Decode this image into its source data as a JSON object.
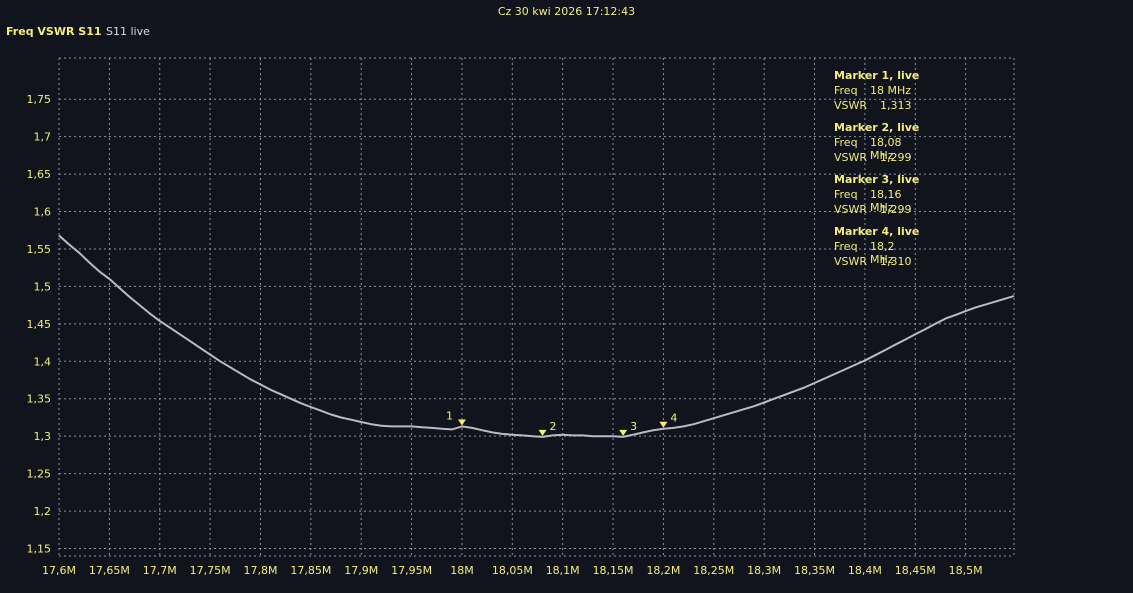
{
  "header": {
    "timestamp": "Cz 30 kwi 2026 17:12:43",
    "chart_title": "Freq VSWR S11",
    "trace_label": "S11 live"
  },
  "colors": {
    "background": "#11141c",
    "grid": "#8e93a0",
    "axis_text": "#f3ee7a",
    "trace": "#b9bcc4",
    "marker": "#f3ee7a"
  },
  "markers_panel": [
    {
      "title": "Marker 1, live",
      "freq_label": "Freq",
      "freq_value": "18 MHz",
      "vswr_label": "VSWR",
      "vswr_value": "1,313"
    },
    {
      "title": "Marker 2, live",
      "freq_label": "Freq",
      "freq_value": "18,08 MHz",
      "vswr_label": "VSWR",
      "vswr_value": "1,299"
    },
    {
      "title": "Marker 3, live",
      "freq_label": "Freq",
      "freq_value": "18,16 MHz",
      "vswr_label": "VSWR",
      "vswr_value": "1,299"
    },
    {
      "title": "Marker 4, live",
      "freq_label": "Freq",
      "freq_value": "18,2 MHz",
      "vswr_label": "VSWR",
      "vswr_value": "1,310"
    }
  ],
  "chart_data": {
    "type": "line",
    "title": "Freq VSWR S11",
    "xlabel": "",
    "ylabel": "",
    "xlim": [
      17.6,
      18.548
    ],
    "ylim": [
      1.14,
      1.805
    ],
    "grid": true,
    "x_ticks": [
      17.6,
      17.65,
      17.7,
      17.75,
      17.8,
      17.85,
      17.9,
      17.95,
      18.0,
      18.05,
      18.1,
      18.15,
      18.2,
      18.25,
      18.3,
      18.35,
      18.4,
      18.45,
      18.5
    ],
    "x_tick_labels": [
      "17,6M",
      "17,65M",
      "17,7M",
      "17,75M",
      "17,8M",
      "17,85M",
      "17,9M",
      "17,95M",
      "18M",
      "18,05M",
      "18,1M",
      "18,15M",
      "18,2M",
      "18,25M",
      "18,3M",
      "18,35M",
      "18,4M",
      "18,45M",
      "18,5M"
    ],
    "y_ticks": [
      1.15,
      1.2,
      1.25,
      1.3,
      1.35,
      1.4,
      1.45,
      1.5,
      1.55,
      1.6,
      1.65,
      1.7,
      1.75
    ],
    "y_tick_labels": [
      "1,15",
      "1,2",
      "1,25",
      "1,3",
      "1,35",
      "1,4",
      "1,45",
      "1,5",
      "1,55",
      "1,6",
      "1,65",
      "1,7",
      "1,75"
    ],
    "series": [
      {
        "x": [
          17.6,
          17.61,
          17.62,
          17.63,
          17.64,
          17.65,
          17.66,
          17.67,
          17.68,
          17.69,
          17.7,
          17.71,
          17.72,
          17.73,
          17.74,
          17.75,
          17.76,
          17.77,
          17.78,
          17.79,
          17.8,
          17.81,
          17.82,
          17.83,
          17.84,
          17.85,
          17.86,
          17.87,
          17.88,
          17.89,
          17.9,
          17.91,
          17.92,
          17.93,
          17.94,
          17.95,
          17.96,
          17.97,
          17.98,
          17.99,
          18.0,
          18.01,
          18.02,
          18.03,
          18.04,
          18.05,
          18.06,
          18.07,
          18.08,
          18.09,
          18.1,
          18.11,
          18.12,
          18.13,
          18.14,
          18.15,
          18.16,
          18.17,
          18.18,
          18.19,
          18.2,
          18.21,
          18.22,
          18.23,
          18.24,
          18.25,
          18.26,
          18.27,
          18.28,
          18.29,
          18.3,
          18.31,
          18.32,
          18.33,
          18.34,
          18.35,
          18.36,
          18.37,
          18.38,
          18.39,
          18.4,
          18.41,
          18.42,
          18.43,
          18.44,
          18.45,
          18.46,
          18.47,
          18.48,
          18.49,
          18.5,
          18.51,
          18.52,
          18.53,
          18.54,
          18.548
        ],
        "y": [
          1.568,
          1.556,
          1.545,
          1.532,
          1.52,
          1.51,
          1.498,
          1.486,
          1.475,
          1.464,
          1.454,
          1.445,
          1.436,
          1.427,
          1.418,
          1.409,
          1.4,
          1.392,
          1.384,
          1.376,
          1.369,
          1.362,
          1.356,
          1.35,
          1.344,
          1.339,
          1.334,
          1.329,
          1.325,
          1.322,
          1.319,
          1.316,
          1.314,
          1.313,
          1.313,
          1.313,
          1.312,
          1.311,
          1.31,
          1.309,
          1.313,
          1.311,
          1.308,
          1.305,
          1.303,
          1.302,
          1.301,
          1.3,
          1.299,
          1.301,
          1.302,
          1.301,
          1.301,
          1.3,
          1.3,
          1.3,
          1.299,
          1.302,
          1.305,
          1.308,
          1.31,
          1.311,
          1.313,
          1.316,
          1.32,
          1.324,
          1.328,
          1.332,
          1.336,
          1.34,
          1.345,
          1.35,
          1.355,
          1.36,
          1.365,
          1.371,
          1.377,
          1.383,
          1.389,
          1.395,
          1.401,
          1.408,
          1.415,
          1.422,
          1.429,
          1.436,
          1.443,
          1.45,
          1.457,
          1.462,
          1.467,
          1.472,
          1.476,
          1.48,
          1.484,
          1.487
        ]
      }
    ],
    "markers": [
      {
        "label": "1",
        "x": 18.0,
        "y": 1.313
      },
      {
        "label": "2",
        "x": 18.08,
        "y": 1.299
      },
      {
        "label": "3",
        "x": 18.16,
        "y": 1.299
      },
      {
        "label": "4",
        "x": 18.2,
        "y": 1.31
      }
    ]
  }
}
